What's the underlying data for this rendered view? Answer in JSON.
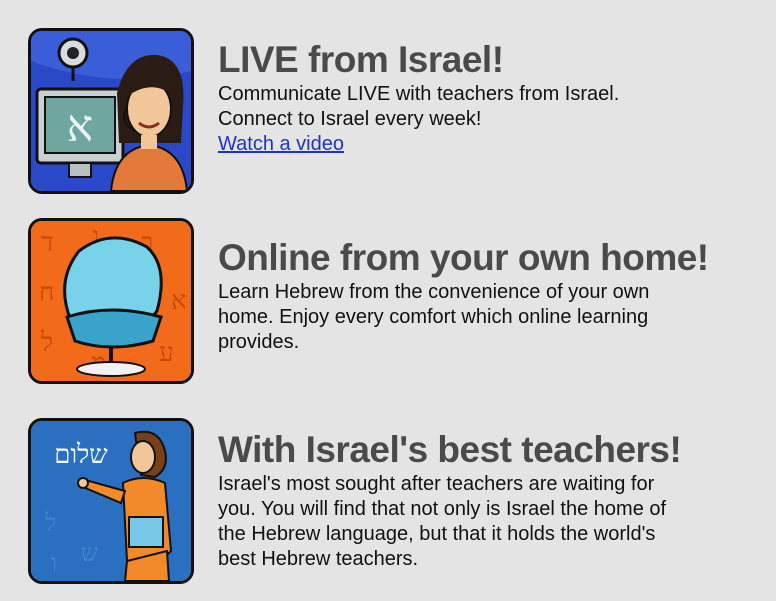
{
  "features": [
    {
      "title": "LIVE from Israel!",
      "lines": [
        "Communicate LIVE with teachers from Israel.",
        "Connect to Israel every week!"
      ],
      "link": "Watch a video",
      "icon": "webcam-teacher-icon"
    },
    {
      "title": "Online from your own home!",
      "lines": [
        "Learn Hebrew from the convenience of your own",
        "home.  Enjoy every comfort which online learning",
        "provides."
      ],
      "icon": "armchair-icon"
    },
    {
      "title": "With Israel's best teachers!",
      "lines": [
        "Israel's most sought after teachers are waiting for",
        "you.  You will find that not only is Israel the home of",
        "the Hebrew language, but that it holds the world's",
        "best Hebrew teachers."
      ],
      "icon": "teacher-blackboard-icon",
      "board_word": "שלום"
    }
  ],
  "colors": {
    "title": "#4a4a4a",
    "link": "#1f33c8",
    "background": "#e4e4e4"
  }
}
